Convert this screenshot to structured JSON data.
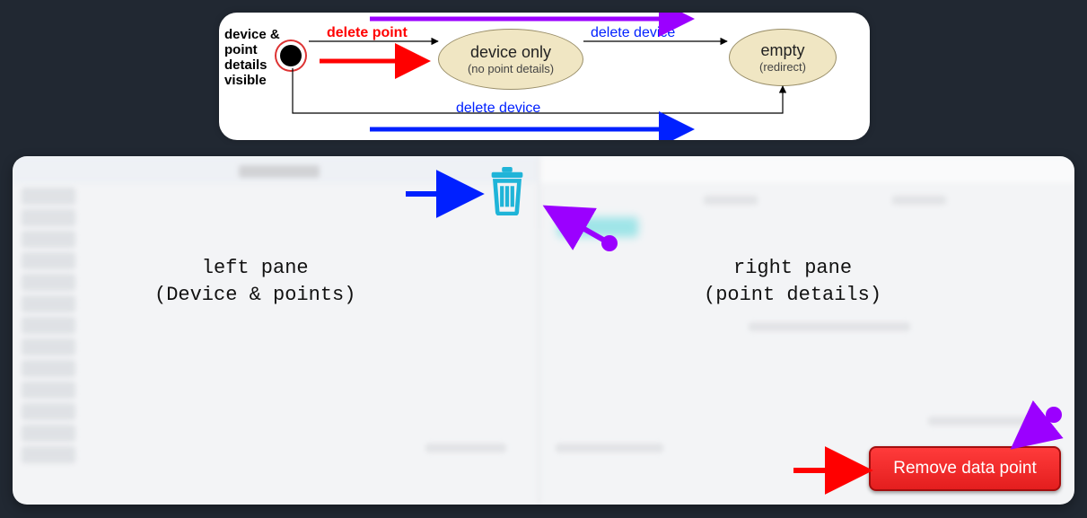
{
  "diagram": {
    "start_label": "device &\npoint\ndetails\nvisible",
    "states": {
      "device_only": {
        "title": "device only",
        "subtitle": "(no point details)"
      },
      "empty": {
        "title": "empty",
        "subtitle": "(redirect)"
      }
    },
    "transitions": {
      "start_to_device": "delete point",
      "device_to_empty": "delete device",
      "start_to_empty": "delete device"
    }
  },
  "mock": {
    "left_pane": "left pane\n(Device & points)",
    "right_pane": "right pane\n(point details)",
    "remove_btn": "Remove data point"
  },
  "colors": {
    "arrow_red": "#ff0000",
    "arrow_blue": "#0020ff",
    "arrow_purple": "#9b00ff",
    "trash": "#1fb4d8",
    "btn_red": "#e92020"
  }
}
